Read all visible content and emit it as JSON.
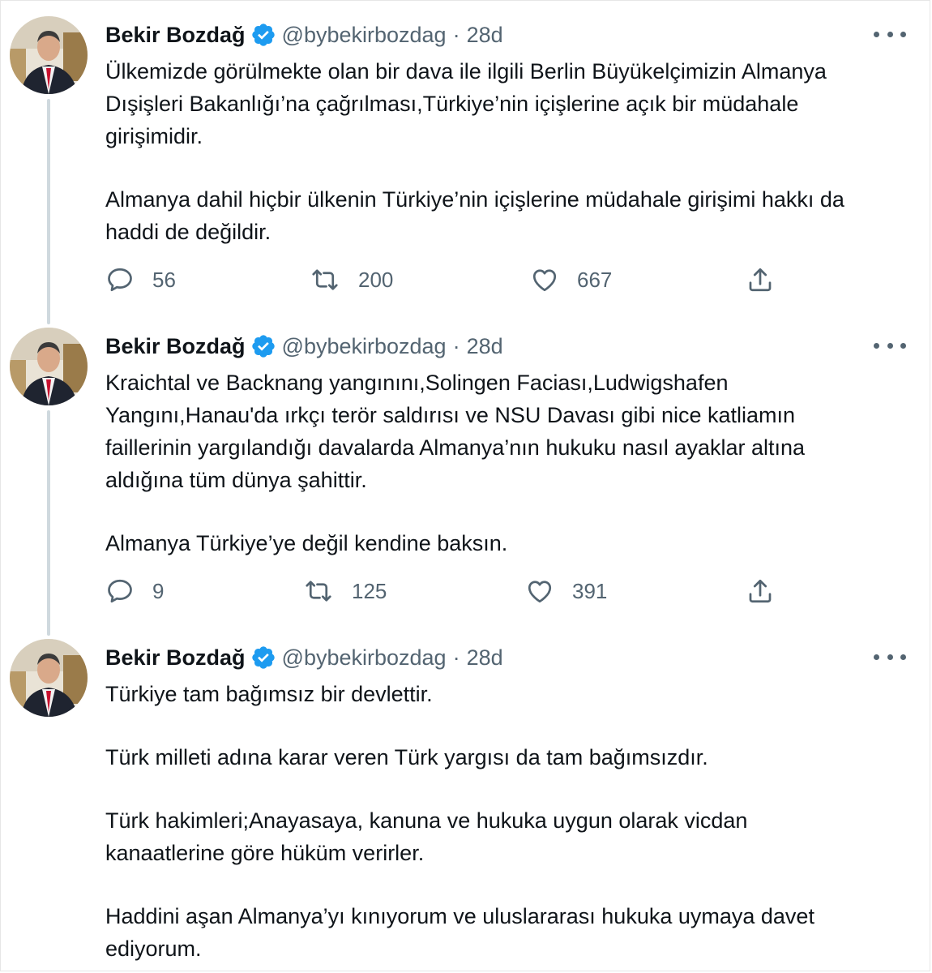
{
  "author": {
    "name": "Bekir Bozdağ",
    "handle": "@bybekirbozdag",
    "separator": "·"
  },
  "colors": {
    "verified_badge": "#1d9bf0",
    "secondary_text": "#536471",
    "thread_line": "#cfd9de"
  },
  "icons": {
    "reply": "speech-bubble",
    "retweet": "two-arrows-loop",
    "like": "heart",
    "share": "upload-arrow",
    "more": "three-dots"
  },
  "tweets": [
    {
      "time": "28d",
      "paragraphs": [
        [
          "Ülkemizde görülmekte olan bir dava ile ilgili Berlin Büyükelçimizin Almanya",
          "Dışişleri Bakanlığı’na çağrılması,Türkiye’nin içişlerine açık bir müdahale",
          "girişimidir."
        ],
        [
          "Almanya dahil hiçbir ülkenin Türkiye’nin içişlerine müdahale girişimi hakkı da",
          "haddi de değildir."
        ]
      ],
      "replies": "56",
      "retweets": "200",
      "likes": "667"
    },
    {
      "time": "28d",
      "paragraphs": [
        [
          "Kraichtal ve Backnang yangınını,Solingen Faciası,Ludwigshafen",
          "Yangını,Hanau'da ırkçı terör saldırısı ve NSU Davası gibi nice katliamın",
          "faillerinin yargılandığı davalarda Almanya’nın hukuku nasıl ayaklar altına",
          "aldığına tüm dünya şahittir."
        ],
        [
          "Almanya Türkiye’ye değil kendine baksın."
        ]
      ],
      "replies": "9",
      "retweets": "125",
      "likes": "391"
    },
    {
      "time": "28d",
      "paragraphs": [
        [
          "Türkiye tam bağımsız bir devlettir."
        ],
        [
          "Türk milleti adına karar veren Türk yargısı da tam bağımsızdır."
        ],
        [
          "Türk hakimleri;Anayasaya, kanuna ve hukuka uygun olarak vicdan",
          "kanaatlerine göre hüküm verirler."
        ],
        [
          "Haddini aşan Almanya’yı kınıyorum ve uluslararası hukuka uymaya davet",
          "ediyorum."
        ]
      ]
    }
  ]
}
